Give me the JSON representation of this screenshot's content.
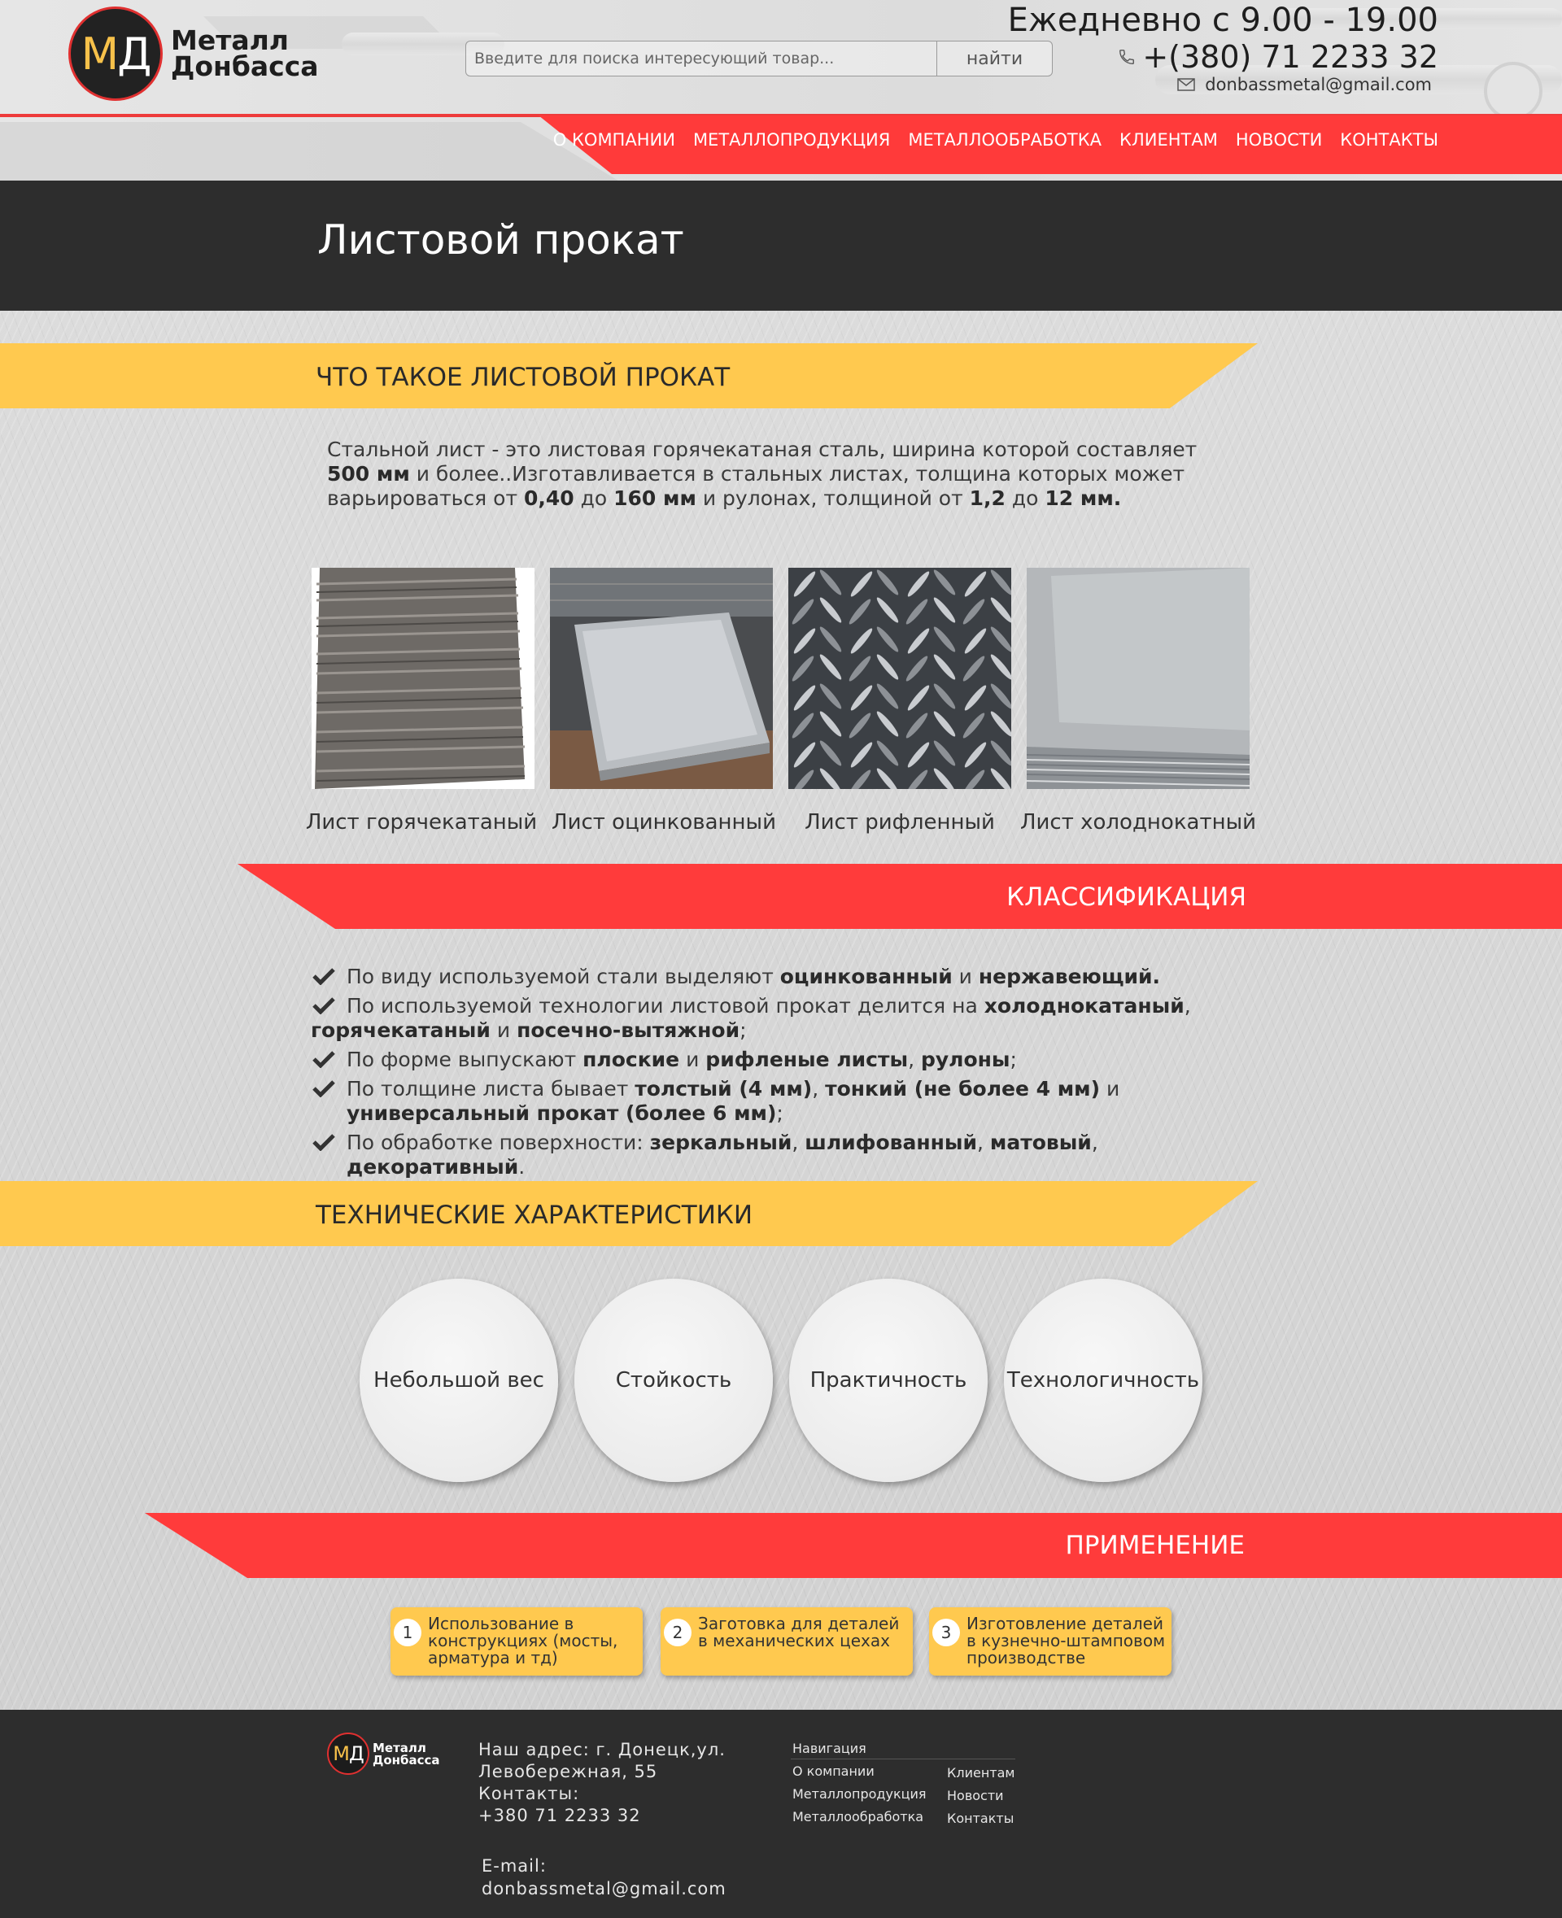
{
  "header": {
    "logo": {
      "letter_m": "М",
      "letter_d": "Д",
      "line1": "Металл",
      "line2": "Донбасса"
    },
    "search": {
      "placeholder": "Введите для поиска интересующий товар...",
      "button_label": "найти"
    },
    "hours": "Ежедневно с 9.00 - 19.00",
    "phone": "+(380) 71 2233 32",
    "email": "donbassmetal@gmail.com"
  },
  "nav": {
    "items": [
      {
        "label": "О КОМПАНИИ"
      },
      {
        "label": "МЕТАЛЛОПРОДУКЦИЯ"
      },
      {
        "label": "МЕТАЛЛООБРАБОТКА"
      },
      {
        "label": "КЛИЕНТАМ"
      },
      {
        "label": "НОВОСТИ"
      },
      {
        "label": "КОНТАКТЫ"
      }
    ]
  },
  "page": {
    "title": "Листовой прокат"
  },
  "sections": {
    "what": {
      "title": "ЧТО ТАКОЕ ЛИСТОВОЙ ПРОКАТ",
      "intro": {
        "p1": "Стальной лист - это листовая горячекатаная сталь, ширина которой составляет",
        "b1": "500 мм",
        "p2": " и более..Изготавливается в стальных листах, толщина которых может варьироваться от ",
        "b2": "0,40",
        "p3": " до ",
        "b3": "160 мм",
        "p4": " и рулонах, толщиной от ",
        "b4": "1,2",
        "p5": " до ",
        "b5": "12 мм."
      }
    },
    "classification": {
      "title": "КЛАССИФИКАЦИЯ"
    },
    "tech": {
      "title": "ТЕХНИЧЕСКИЕ ХАРАКТЕРИСТИКИ"
    },
    "application": {
      "title": "ПРИМЕНЕНИЕ"
    }
  },
  "products": [
    {
      "caption": "Лист горячекатаный"
    },
    {
      "caption": "Лист оцинкованный"
    },
    {
      "caption": "Лист рифленный"
    },
    {
      "caption": "Лист холоднокатный"
    }
  ],
  "classification_items": [
    {
      "t1": "По виду используемой стали выделяют ",
      "b1": "оцинкованный",
      "t2": " и ",
      "b2": "нержавеющий.",
      "t3": ""
    },
    {
      "t1": "По используемой технологии листовой прокат делится на ",
      "b1": "холоднокатаный",
      "t2": ", ",
      "b2": "горячекатаный",
      "t3": " и ",
      "b3": "посечно-вытяжной",
      "t4": ";"
    },
    {
      "t1": "По форме выпускают ",
      "b1": "плоские",
      "t2": " и ",
      "b2": "рифленые листы",
      "t3": ", ",
      "b3": "рулоны",
      "t4": ";"
    },
    {
      "t1": "По толщине листа бывает ",
      "b1": "толстый (4 мм)",
      "t2": ", ",
      "b2": "тонкий (не более 4 мм)",
      "t3": " и ",
      "b3": "универсальный прокат (более 6 мм)",
      "t4": ";"
    },
    {
      "t1": "По обработке поверхности: ",
      "b1": "зеркальный",
      "t2": ", ",
      "b2": "шлифованный",
      "t3": ", ",
      "b3": "матовый",
      "t4": ", ",
      "b4": "декоративный",
      "t5": "."
    }
  ],
  "features": [
    {
      "label": "Небольшой вес"
    },
    {
      "label": "Стойкость"
    },
    {
      "label": "Практичность"
    },
    {
      "label": "Технологичность"
    }
  ],
  "applications": [
    {
      "num": "1",
      "text": "Использование в конструкциях (мосты, арматура и тд)"
    },
    {
      "num": "2",
      "text": "Заготовка для деталей в механических цехах"
    },
    {
      "num": "3",
      "text": "Изготовление деталей в кузнечно-штамповом производстве"
    }
  ],
  "footer": {
    "logo_line1": "Металл",
    "logo_line2": "Донбасса",
    "address_line1": "Наш адрес: г. Донецк,ул.",
    "address_line2": "Левобережная, 55",
    "contacts_label": "Контакты:",
    "phone": "+380 71 2233 32",
    "email_label": "E-mail:",
    "email": "donbassmetal@gmail.com",
    "nav_title": "Навигация",
    "links": [
      {
        "label": "О компании"
      },
      {
        "label": "Металлопродукция"
      },
      {
        "label": "Металлообработка"
      },
      {
        "label": "Клиентам"
      },
      {
        "label": "Новости"
      },
      {
        "label": "Контакты"
      }
    ]
  },
  "colors": {
    "accent_red": "#ff3a3a",
    "accent_yellow": "#ffc94f",
    "dark_band": "#2d2d2d"
  }
}
